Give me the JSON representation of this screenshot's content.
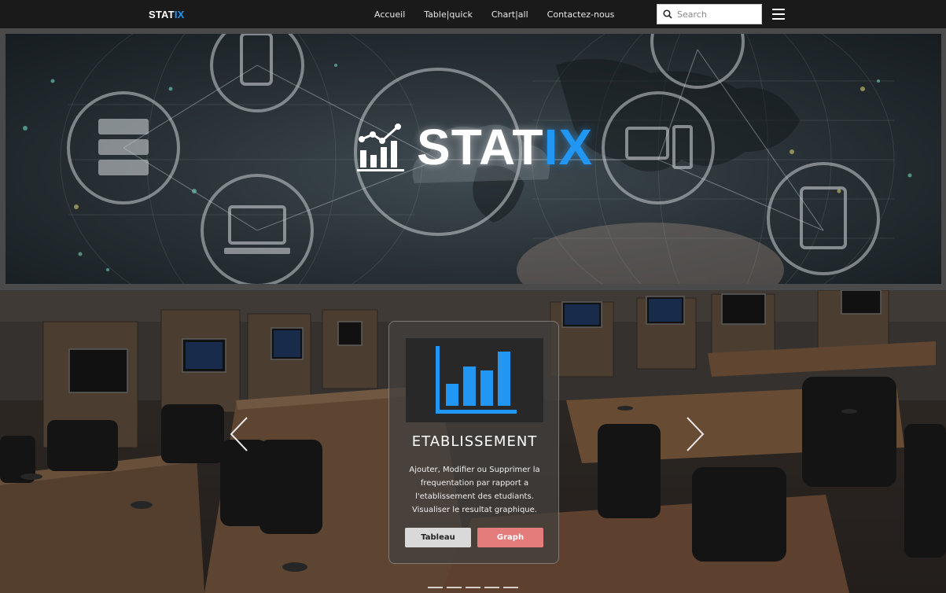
{
  "navbar": {
    "brand_main": "STAT",
    "brand_accent": "IX",
    "links": [
      "Accueil",
      "Table|quick",
      "Chart|all",
      "Contactez-nous"
    ],
    "search_placeholder": "Search"
  },
  "banner": {
    "logo_main": "STAT",
    "logo_accent": "IX"
  },
  "hero": {
    "card": {
      "title": "ETABLISSEMENT",
      "description": "Ajouter, Modifier ou Supprimer la frequentation par rapport a l'etablissement des etudiants. Visualiser le resultat graphique.",
      "button_tableau": "Tableau",
      "button_graph": "Graph"
    },
    "indicator_count": 5
  },
  "colors": {
    "accent": "#2196f3",
    "navbar_bg": "#1a1a1a",
    "graph_button": "#e57c7c",
    "tableau_button": "#d9d9d9"
  },
  "icons": [
    "search-icon",
    "menu-icon",
    "chart-logo-icon",
    "bar-chart-icon",
    "chevron-left-icon",
    "chevron-right-icon"
  ]
}
